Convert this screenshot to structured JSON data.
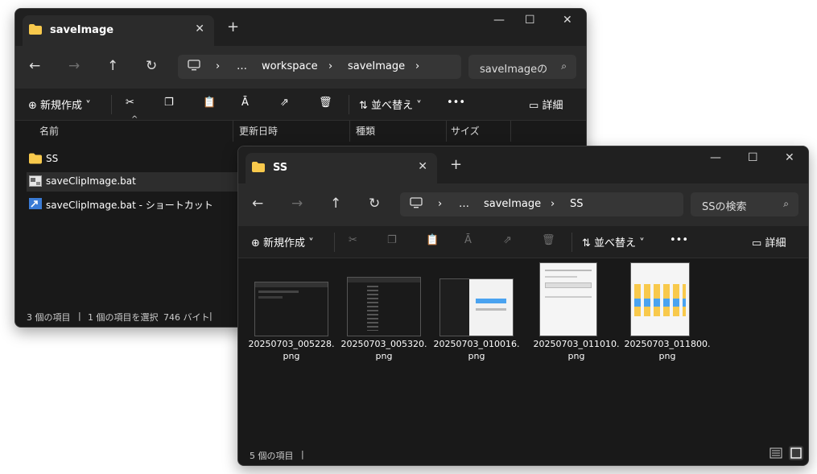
{
  "window1": {
    "tab_title": "saveImage",
    "tab_close": "✕",
    "new_tab": "+",
    "window_controls": [
      "—",
      "☐",
      "✕"
    ],
    "breadcrumb": [
      "…",
      "workspace",
      "saveImage"
    ],
    "search_placeholder": "saveImageの",
    "toolbar": {
      "new_label": "新規作成",
      "sort_label": "並べ替え",
      "more_label": "•••",
      "details_label": "詳細"
    },
    "columns": [
      "名前",
      "更新日時",
      "種類",
      "サイズ"
    ],
    "files": [
      {
        "name": "SS",
        "icon": "folder-icon"
      },
      {
        "name": "saveClipImage.bat",
        "icon": "bat-file-icon"
      },
      {
        "name": "saveClipImage.bat - ショートカット",
        "icon": "shortcut-icon"
      }
    ],
    "status": {
      "count": "3 個の項目",
      "selected": "1 個の項目を選択",
      "size": "746 バイト"
    }
  },
  "window2": {
    "tab_title": "SS",
    "tab_close": "✕",
    "new_tab": "+",
    "window_controls": [
      "—",
      "☐",
      "✕"
    ],
    "breadcrumb": [
      "…",
      "saveImage",
      "SS"
    ],
    "search_placeholder": "SSの検索",
    "toolbar": {
      "new_label": "新規作成",
      "sort_label": "並べ替え",
      "more_label": "•••",
      "details_label": "詳細"
    },
    "files": [
      {
        "name_line1": "20250703_005228.",
        "name_line2": "png"
      },
      {
        "name_line1": "20250703_005320.",
        "name_line2": "png"
      },
      {
        "name_line1": "20250703_010016.",
        "name_line2": "png"
      },
      {
        "name_line1": "20250703_011010.",
        "name_line2": "png"
      },
      {
        "name_line1": "20250703_011800.",
        "name_line2": "png"
      }
    ],
    "status": {
      "count": "5 個の項目"
    }
  },
  "colors": {
    "folder": "#f8c94c",
    "accent": "#4aa3f0",
    "bg": "#191919"
  }
}
